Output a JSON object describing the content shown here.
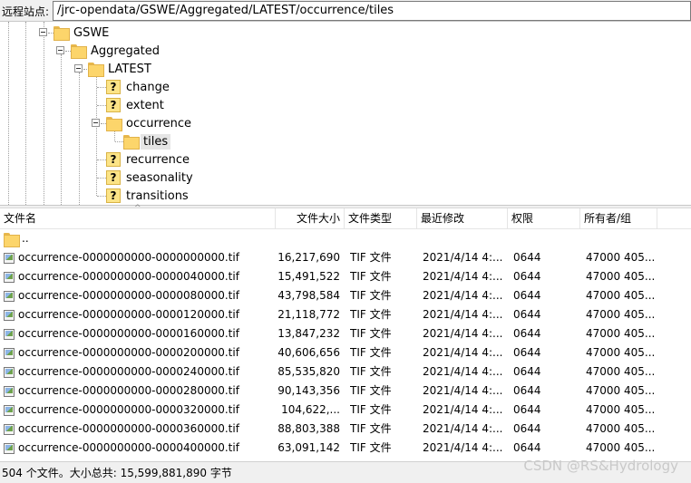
{
  "pathbar": {
    "label": "远程站点:",
    "path": "/jrc-opendata/GSWE/Aggregated/LATEST/occurrence/tiles"
  },
  "tree": {
    "gswe": "GSWE",
    "aggregated": "Aggregated",
    "latest": "LATEST",
    "change": "change",
    "extent": "extent",
    "occurrence": "occurrence",
    "tiles": "tiles",
    "recurrence": "recurrence",
    "seasonality": "seasonality",
    "transitions": "transitions"
  },
  "columns": {
    "name": "文件名",
    "size": "文件大小",
    "type": "文件类型",
    "modified": "最近修改",
    "perms": "权限",
    "owner": "所有者/组"
  },
  "parent_row": "..",
  "files": [
    {
      "name": "occurrence-0000000000-0000000000.tif",
      "size": "16,217,690",
      "type": "TIF 文件",
      "modified": "2021/4/14 4:...",
      "perms": "0644",
      "owner": "47000 405..."
    },
    {
      "name": "occurrence-0000000000-0000040000.tif",
      "size": "15,491,522",
      "type": "TIF 文件",
      "modified": "2021/4/14 4:...",
      "perms": "0644",
      "owner": "47000 405..."
    },
    {
      "name": "occurrence-0000000000-0000080000.tif",
      "size": "43,798,584",
      "type": "TIF 文件",
      "modified": "2021/4/14 4:...",
      "perms": "0644",
      "owner": "47000 405..."
    },
    {
      "name": "occurrence-0000000000-0000120000.tif",
      "size": "21,118,772",
      "type": "TIF 文件",
      "modified": "2021/4/14 4:...",
      "perms": "0644",
      "owner": "47000 405..."
    },
    {
      "name": "occurrence-0000000000-0000160000.tif",
      "size": "13,847,232",
      "type": "TIF 文件",
      "modified": "2021/4/14 4:...",
      "perms": "0644",
      "owner": "47000 405..."
    },
    {
      "name": "occurrence-0000000000-0000200000.tif",
      "size": "40,606,656",
      "type": "TIF 文件",
      "modified": "2021/4/14 4:...",
      "perms": "0644",
      "owner": "47000 405..."
    },
    {
      "name": "occurrence-0000000000-0000240000.tif",
      "size": "85,535,820",
      "type": "TIF 文件",
      "modified": "2021/4/14 4:...",
      "perms": "0644",
      "owner": "47000 405..."
    },
    {
      "name": "occurrence-0000000000-0000280000.tif",
      "size": "90,143,356",
      "type": "TIF 文件",
      "modified": "2021/4/14 4:...",
      "perms": "0644",
      "owner": "47000 405..."
    },
    {
      "name": "occurrence-0000000000-0000320000.tif",
      "size": "104,622,...",
      "type": "TIF 文件",
      "modified": "2021/4/14 4:...",
      "perms": "0644",
      "owner": "47000 405..."
    },
    {
      "name": "occurrence-0000000000-0000360000.tif",
      "size": "88,803,388",
      "type": "TIF 文件",
      "modified": "2021/4/14 4:...",
      "perms": "0644",
      "owner": "47000 405..."
    },
    {
      "name": "occurrence-0000000000-0000400000.tif",
      "size": "63,091,142",
      "type": "TIF 文件",
      "modified": "2021/4/14 4:...",
      "perms": "0644",
      "owner": "47000 405..."
    }
  ],
  "status": "504 个文件。大小总共: 15,599,881,890 字节",
  "watermark": "CSDN @RS&Hydrology"
}
